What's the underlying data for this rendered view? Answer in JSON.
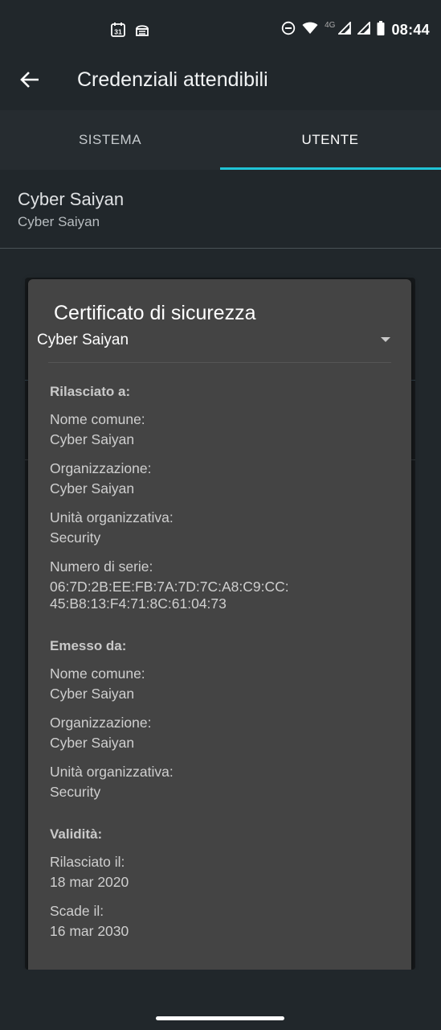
{
  "status_bar": {
    "left_icons": [
      "calendar-icon",
      "sim-manager-icon"
    ],
    "right_icons": [
      "dnd-icon",
      "wifi-icon",
      "signal-icon",
      "signal-icon",
      "battery-icon"
    ],
    "network": "4G",
    "calendar_day": "31",
    "time": "08:44"
  },
  "app_bar": {
    "title": "Credenziali attendibili",
    "back_icon": "arrow-left-icon"
  },
  "tabs": [
    {
      "label": "SISTEMA",
      "selected": false
    },
    {
      "label": "UTENTE",
      "selected": true
    }
  ],
  "colors": {
    "accent": "#20c4d6",
    "background": "#21272b",
    "dialog": "#444444"
  },
  "list": {
    "items": [
      {
        "title": "Cyber Saiyan",
        "subtitle": "Cyber Saiyan"
      }
    ]
  },
  "dialog": {
    "title": "Certificato di sicurezza",
    "selected_certificate": "Cyber Saiyan",
    "issued_to": {
      "heading": "Rilasciato a:",
      "common_name_label": "Nome comune:",
      "common_name": "Cyber Saiyan",
      "organization_label": "Organizzazione:",
      "organization": "Cyber Saiyan",
      "org_unit_label": "Unità organizzativa:",
      "org_unit": "Security",
      "serial_label": "Numero di serie:",
      "serial_line1": "06:7D:2B:EE:FB:7A:7D:7C:A8:C9:CC:",
      "serial_line2": "45:B8:13:F4:71:8C:61:04:73"
    },
    "issued_by": {
      "heading": "Emesso da:",
      "common_name_label": "Nome comune:",
      "common_name": "Cyber Saiyan",
      "organization_label": "Organizzazione:",
      "organization": "Cyber Saiyan",
      "org_unit_label": "Unità organizzativa:",
      "org_unit": "Security"
    },
    "validity": {
      "heading": "Validità:",
      "issued_on_label": "Rilasciato il:",
      "issued_on": "18 mar 2020",
      "expires_label": "Scade il:",
      "expires": "16 mar 2030"
    }
  }
}
